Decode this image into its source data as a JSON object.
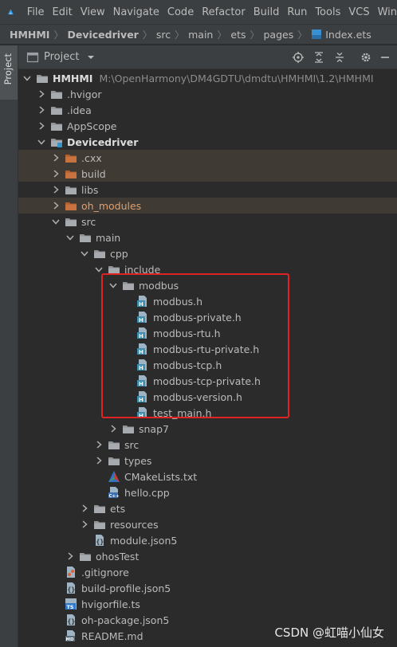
{
  "menubar": {
    "items": [
      "File",
      "Edit",
      "View",
      "Navigate",
      "Code",
      "Refactor",
      "Build",
      "Run",
      "Tools",
      "VCS",
      "Win"
    ]
  },
  "breadcrumb": {
    "items": [
      "HMHMI",
      "Devicedriver",
      "src",
      "main",
      "ets",
      "pages",
      "Index.ets"
    ]
  },
  "toolstrip": {
    "project_tab": "Project"
  },
  "panel": {
    "title": "Project"
  },
  "tree": [
    {
      "label": "HMHMI",
      "path": "M:\\OpenHarmony\\DM4GDTU\\dmdtu\\HMHMI\\1.2\\HMHMI",
      "depth": 0,
      "arrow": "down",
      "icon": "folder",
      "bold": true
    },
    {
      "label": ".hvigor",
      "depth": 1,
      "arrow": "right",
      "icon": "folder"
    },
    {
      "label": ".idea",
      "depth": 1,
      "arrow": "right",
      "icon": "folder"
    },
    {
      "label": "AppScope",
      "depth": 1,
      "arrow": "right",
      "icon": "folder"
    },
    {
      "label": "Devicedriver",
      "depth": 1,
      "arrow": "down",
      "icon": "folder-module",
      "bold": true
    },
    {
      "label": ".cxx",
      "depth": 2,
      "arrow": "right",
      "icon": "folder-orange",
      "excluded": true
    },
    {
      "label": "build",
      "depth": 2,
      "arrow": "right",
      "icon": "folder-orange",
      "excluded": true
    },
    {
      "label": "libs",
      "depth": 2,
      "arrow": "right",
      "icon": "folder"
    },
    {
      "label": "oh_modules",
      "depth": 2,
      "arrow": "right",
      "icon": "folder-orange",
      "excluded": true,
      "orange": true
    },
    {
      "label": "src",
      "depth": 2,
      "arrow": "down",
      "icon": "folder"
    },
    {
      "label": "main",
      "depth": 3,
      "arrow": "down",
      "icon": "folder"
    },
    {
      "label": "cpp",
      "depth": 4,
      "arrow": "down",
      "icon": "folder"
    },
    {
      "label": "include",
      "depth": 5,
      "arrow": "down",
      "icon": "folder"
    },
    {
      "label": "modbus",
      "depth": 6,
      "arrow": "down",
      "icon": "folder"
    },
    {
      "label": "modbus.h",
      "depth": 7,
      "icon": "header"
    },
    {
      "label": "modbus-private.h",
      "depth": 7,
      "icon": "header"
    },
    {
      "label": "modbus-rtu.h",
      "depth": 7,
      "icon": "header"
    },
    {
      "label": "modbus-rtu-private.h",
      "depth": 7,
      "icon": "header"
    },
    {
      "label": "modbus-tcp.h",
      "depth": 7,
      "icon": "header"
    },
    {
      "label": "modbus-tcp-private.h",
      "depth": 7,
      "icon": "header"
    },
    {
      "label": "modbus-version.h",
      "depth": 7,
      "icon": "header"
    },
    {
      "label": "test_main.h",
      "depth": 7,
      "icon": "header"
    },
    {
      "label": "snap7",
      "depth": 6,
      "arrow": "right",
      "icon": "folder"
    },
    {
      "label": "src",
      "depth": 5,
      "arrow": "right",
      "icon": "folder"
    },
    {
      "label": "types",
      "depth": 5,
      "arrow": "right",
      "icon": "folder"
    },
    {
      "label": "CMakeLists.txt",
      "depth": 5,
      "icon": "cmake"
    },
    {
      "label": "hello.cpp",
      "depth": 5,
      "icon": "cpp"
    },
    {
      "label": "ets",
      "depth": 4,
      "arrow": "right",
      "icon": "folder"
    },
    {
      "label": "resources",
      "depth": 4,
      "arrow": "right",
      "icon": "folder"
    },
    {
      "label": "module.json5",
      "depth": 4,
      "icon": "json"
    },
    {
      "label": "ohosTest",
      "depth": 3,
      "arrow": "right",
      "icon": "folder"
    },
    {
      "label": ".gitignore",
      "depth": 2,
      "icon": "git"
    },
    {
      "label": "build-profile.json5",
      "depth": 2,
      "icon": "json"
    },
    {
      "label": "hvigorfile.ts",
      "depth": 2,
      "icon": "ts"
    },
    {
      "label": "oh-package.json5",
      "depth": 2,
      "icon": "json"
    },
    {
      "label": "README.md",
      "depth": 2,
      "icon": "md"
    }
  ],
  "watermark": "CSDN @虹喵小仙女",
  "colors": {
    "background": "#2b2b2b",
    "chrome": "#3c3f41",
    "text": "#bbbbbb",
    "folder": "#8f9398",
    "excluded_folder": "#c7723f",
    "excluded_row": "#3f3a33",
    "header_icon": "#41a6c4",
    "highlight": "#e02424"
  }
}
